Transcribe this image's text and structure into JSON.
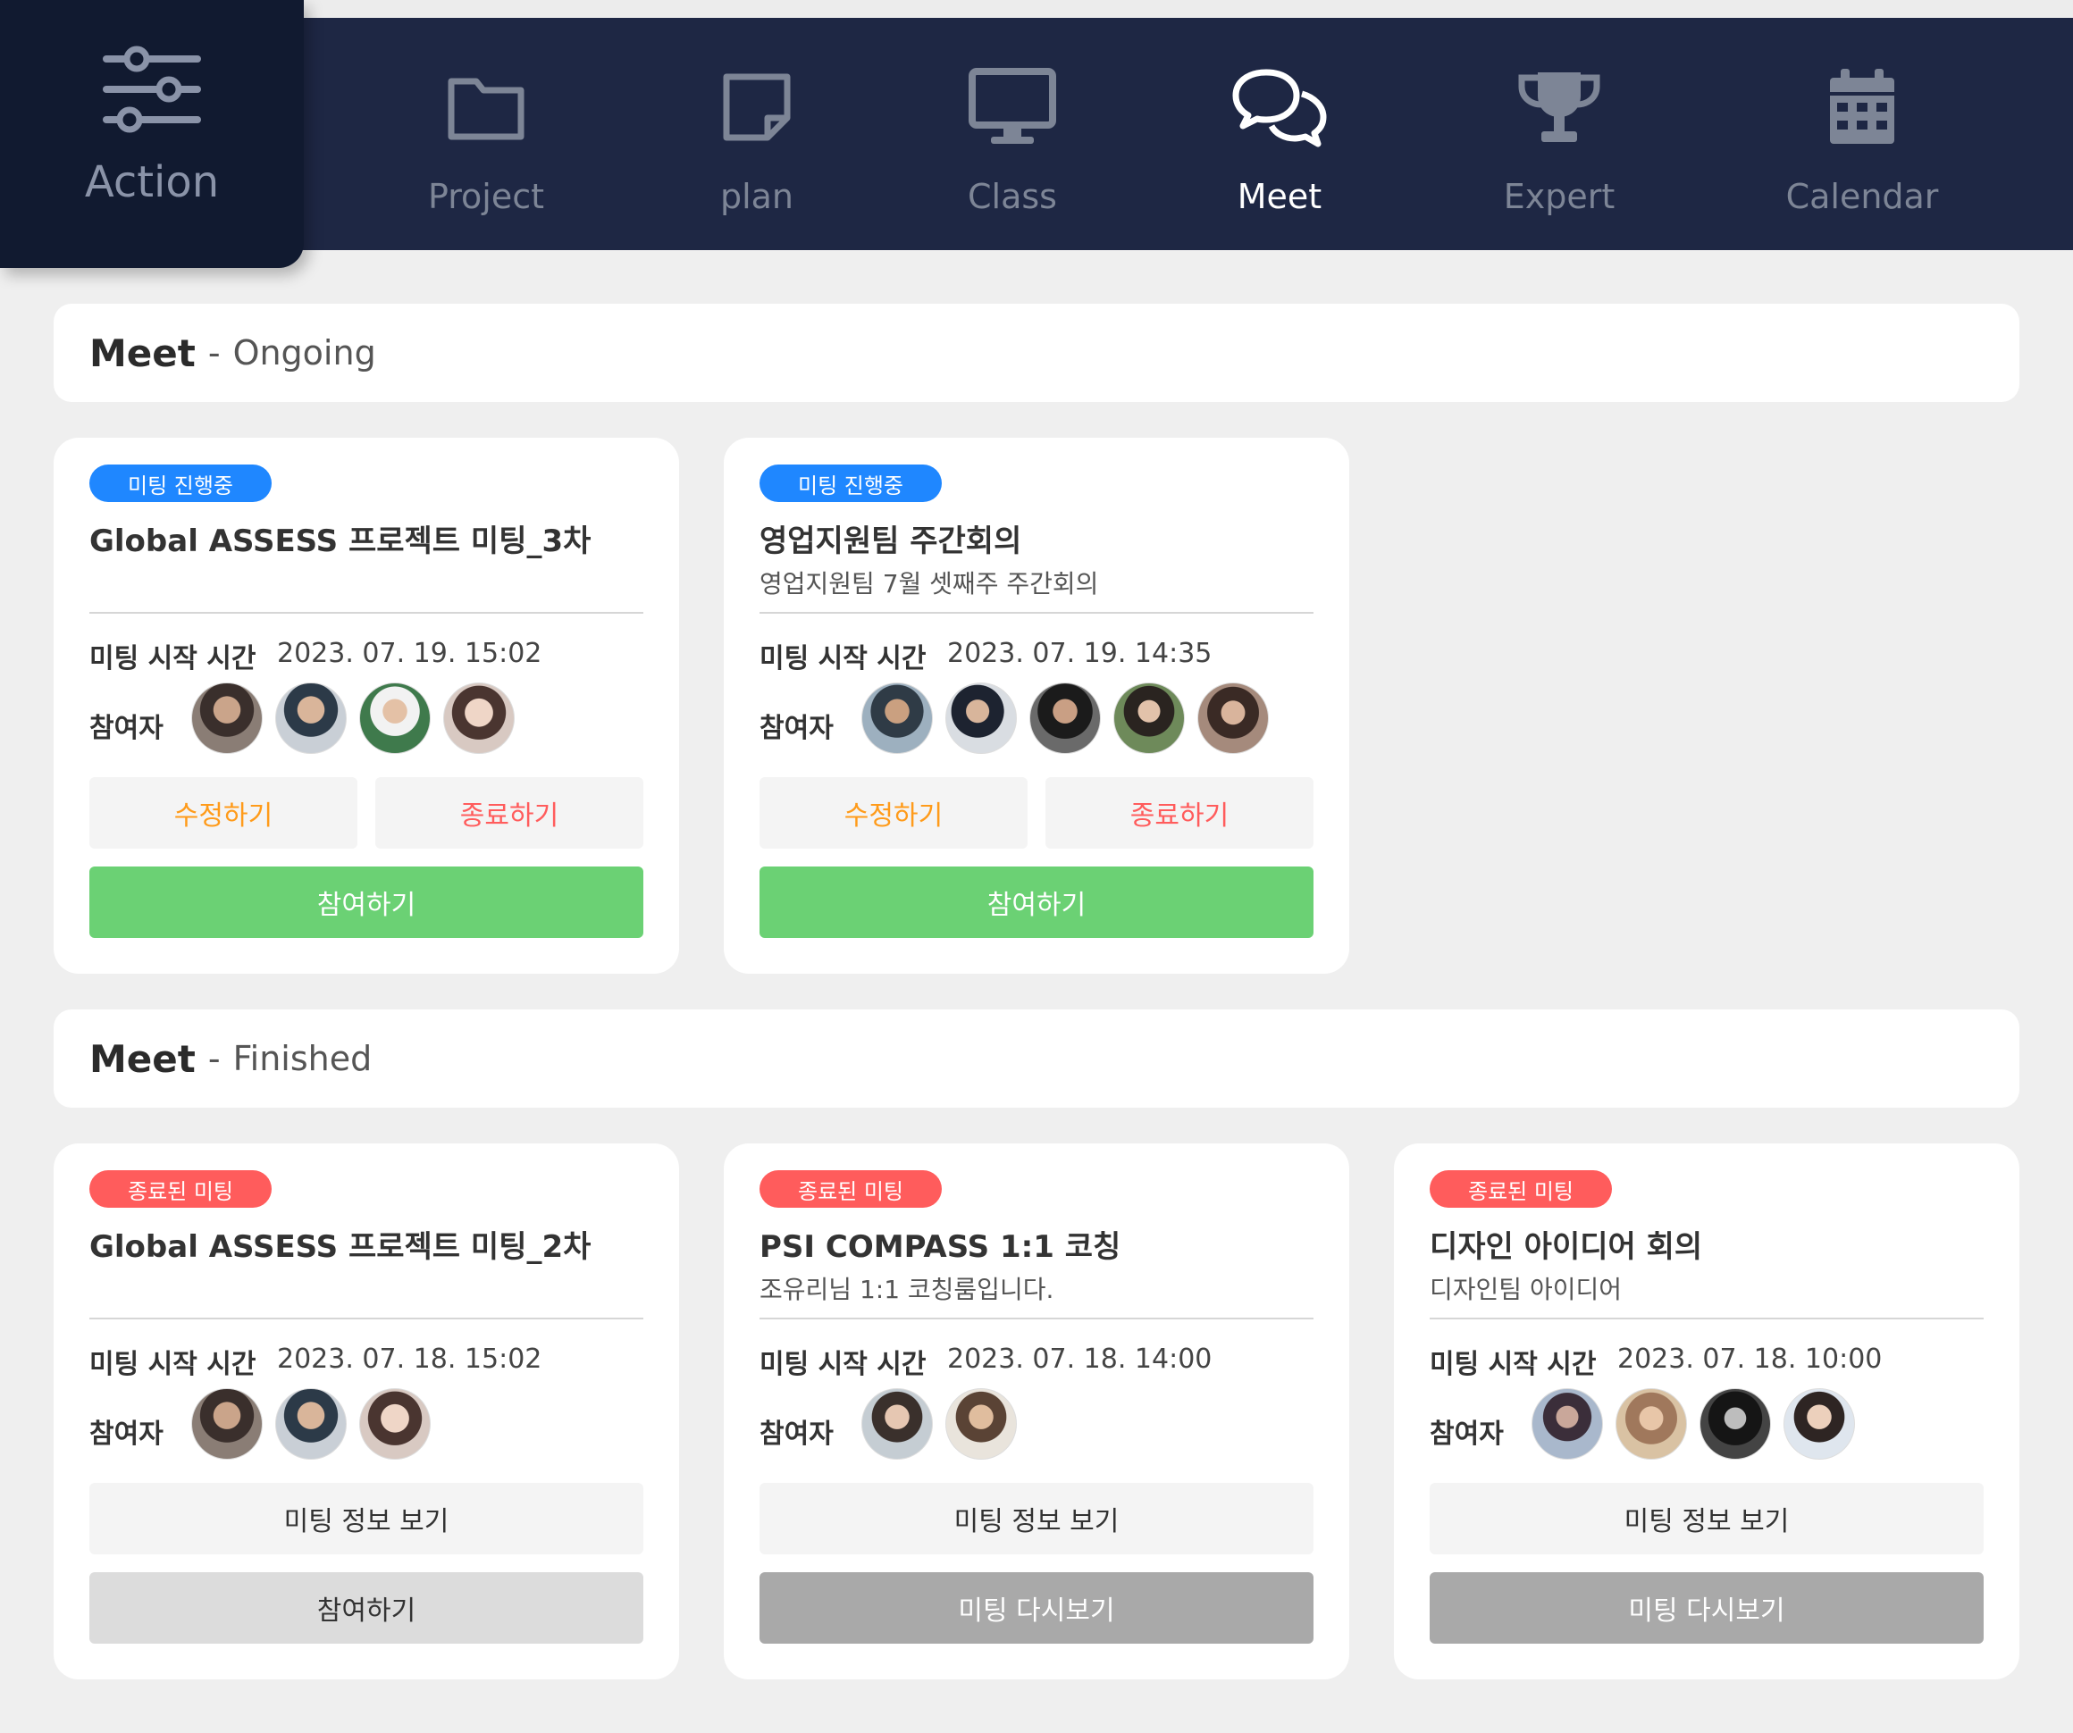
{
  "nav": {
    "action_label": "Action",
    "items": [
      {
        "label": "Project",
        "icon": "folder-icon"
      },
      {
        "label": "plan",
        "icon": "note-icon"
      },
      {
        "label": "Class",
        "icon": "monitor-icon"
      },
      {
        "label": "Meet",
        "icon": "chat-bubbles-icon"
      },
      {
        "label": "Expert",
        "icon": "trophy-icon"
      },
      {
        "label": "Calendar",
        "icon": "calendar-icon"
      }
    ],
    "active": "Meet"
  },
  "ongoing": {
    "title": "Meet",
    "dash": "-",
    "status": "Ongoing",
    "cards": [
      {
        "badge": "미팅 진행중",
        "title": "Global ASSESS 프로젝트 미팅_3차",
        "desc": "",
        "time_label": "미팅 시작 시간",
        "time": "2023. 07. 19. 15:02",
        "participants_label": "참여자",
        "participants_count": 4,
        "edit_label": "수정하기",
        "end_label": "종료하기",
        "join_label": "참여하기"
      },
      {
        "badge": "미팅 진행중",
        "title": "영업지원팀 주간회의",
        "desc": "영업지원팀 7월 셋째주 주간회의",
        "time_label": "미팅 시작 시간",
        "time": "2023. 07. 19. 14:35",
        "participants_label": "참여자",
        "participants_count": 5,
        "edit_label": "수정하기",
        "end_label": "종료하기",
        "join_label": "참여하기"
      }
    ]
  },
  "finished": {
    "title": "Meet",
    "dash": "-",
    "status": "Finished",
    "cards": [
      {
        "badge": "종료된 미팅",
        "title": "Global ASSESS 프로젝트 미팅_2차",
        "desc": "",
        "time_label": "미팅 시작 시간",
        "time": "2023. 07. 18. 15:02",
        "participants_label": "참여자",
        "participants_count": 3,
        "info_label": "미팅 정보 보기",
        "action_label": "참여하기"
      },
      {
        "badge": "종료된 미팅",
        "title": "PSI COMPASS 1:1 코칭",
        "desc": "조유리님 1:1 코칭룸입니다.",
        "time_label": "미팅 시작 시간",
        "time": "2023. 07. 18. 14:00",
        "participants_label": "참여자",
        "participants_count": 2,
        "info_label": "미팅 정보 보기",
        "action_label": "미팅 다시보기"
      },
      {
        "badge": "종료된 미팅",
        "title": "디자인 아이디어 회의",
        "desc": "디자인팀 아이디어",
        "time_label": "미팅 시작 시간",
        "time": "2023. 07. 18. 10:00",
        "participants_label": "참여자",
        "participants_count": 4,
        "info_label": "미팅 정보 보기",
        "action_label": "미팅 다시보기"
      }
    ]
  },
  "colors": {
    "navbar": "#1e2744",
    "action_tab": "#111a30",
    "badge_ongoing": "#1f87ff",
    "badge_finished": "#ff5c5c",
    "join_button": "#6bd174",
    "edit_text": "#ff9b1a",
    "end_text": "#ff5c5c"
  }
}
